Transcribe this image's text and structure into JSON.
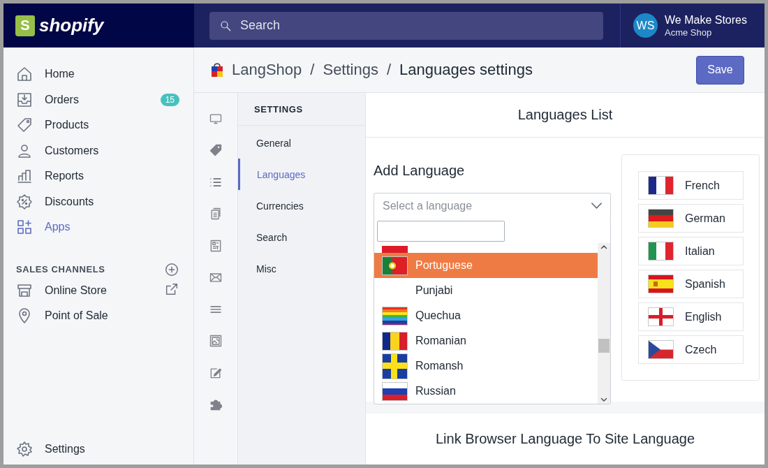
{
  "topbar": {
    "logo_mark": "S",
    "logo_text": "shopify",
    "search": {
      "placeholder": "Search"
    },
    "user": {
      "initials": "WS",
      "name": "We Make Stores",
      "shop": "Acme Shop"
    }
  },
  "sidebar": {
    "items": [
      {
        "label": "Home",
        "selected": false
      },
      {
        "label": "Orders",
        "badge": "15",
        "selected": false
      },
      {
        "label": "Products",
        "selected": false
      },
      {
        "label": "Customers",
        "selected": false
      },
      {
        "label": "Reports",
        "selected": false
      },
      {
        "label": "Discounts",
        "selected": false
      },
      {
        "label": "Apps",
        "selected": true
      }
    ],
    "sales_channels": {
      "title": "SALES CHANNELS",
      "items": [
        {
          "label": "Online Store"
        },
        {
          "label": "Point of Sale"
        }
      ]
    },
    "settings_link": "Settings"
  },
  "breadcrumb": {
    "items": [
      "LangShop",
      "Settings"
    ],
    "separator": "/",
    "current": "Languages settings"
  },
  "save_button": "Save",
  "settings_nav": {
    "title": "SETTINGS",
    "items": [
      {
        "label": "General",
        "selected": false
      },
      {
        "label": "Languages",
        "selected": true
      },
      {
        "label": "Currencies",
        "selected": false
      },
      {
        "label": "Search",
        "selected": false
      },
      {
        "label": "Misc",
        "selected": false
      }
    ]
  },
  "languages_list": {
    "title": "Languages List"
  },
  "add_language": {
    "title": "Add Language",
    "select": {
      "placeholder": "Select a language",
      "expanded": true
    },
    "options": [
      {
        "label": "Portuguese",
        "selected": true
      },
      {
        "label": "Punjabi",
        "selected": false
      },
      {
        "label": "Quechua",
        "selected": false
      },
      {
        "label": "Romanian",
        "selected": false
      },
      {
        "label": "Romansh",
        "selected": false
      },
      {
        "label": "Russian",
        "selected": false
      }
    ]
  },
  "active_languages": [
    "French",
    "German",
    "Italian",
    "Spanish",
    "English",
    "Czech"
  ],
  "link_section": {
    "title": "Link Browser Language To Site Language"
  }
}
